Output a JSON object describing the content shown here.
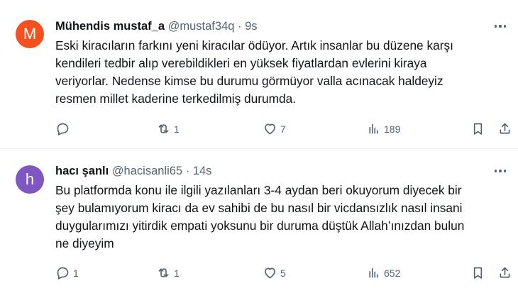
{
  "tweets": [
    {
      "avatar_letter": "M",
      "avatar_color": "#f4511e",
      "name": "Mühendis mustaf_a",
      "handle": "@mustaf34q",
      "separator": "·",
      "time": "9s",
      "text": "Eski kiracıların farkını yeni kiracılar ödüyor. Artık insanlar bu düzene karşı\nkendileri tedbir alıp verebildikleri en yüksek fiyatlardan evlerini kiraya\nveriyorlar. Nedense kimse bu durumu görmüyor valla acınacak haldeyiz\nresmen millet kaderine terkedilmiş durumda.",
      "replies": "",
      "reposts": "1",
      "likes": "7",
      "views": "189"
    },
    {
      "avatar_letter": "h",
      "avatar_color": "#7e57c2",
      "name": "hacı şanlı",
      "handle": "@hacisanli65",
      "separator": "·",
      "time": "14s",
      "text": "Bu platformda konu ile ilgili yazılanları 3-4 aydan beri okuyorum diyecek bir\nşey bulamıyorum kiracı da ev sahibi de bu nasıl bir vicdansızlık nasıl insani\nduygularımızı yitirdik empati yoksunu bir duruma düştük Allah’ınızdan bulun\nne diyeyim",
      "replies": "1",
      "reposts": "1",
      "likes": "5",
      "views": "652"
    }
  ],
  "icons": [
    "reply-icon",
    "repost-icon",
    "like-icon",
    "views-icon",
    "bookmark-icon",
    "share-icon",
    "more-icon"
  ],
  "colors": {
    "text": "#0f1419",
    "secondary": "#536471",
    "divider": "#eff3f4"
  }
}
